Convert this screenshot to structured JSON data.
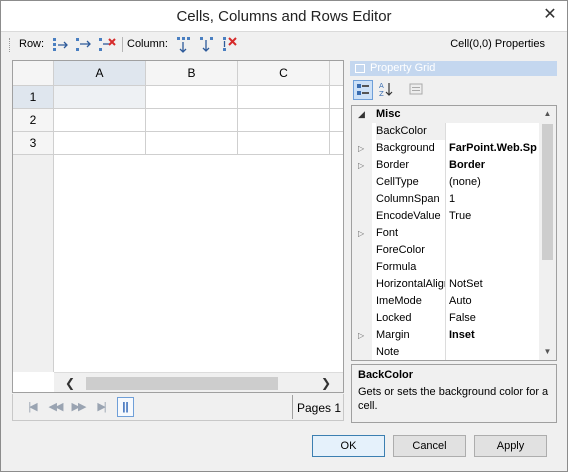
{
  "window": {
    "title": "Cells, Columns and Rows Editor"
  },
  "toolbar": {
    "row_label": "Row:",
    "column_label": "Column:",
    "row_icons": [
      "insert-row-icon",
      "append-row-icon",
      "delete-row-icon"
    ],
    "column_icons": [
      "insert-column-icon",
      "append-column-icon",
      "delete-column-icon"
    ],
    "selection_label": "Cell(0,0) Properties"
  },
  "sheet": {
    "columns": [
      "A",
      "B",
      "C"
    ],
    "rows": [
      "1",
      "2",
      "3"
    ],
    "selected_cell": "A1"
  },
  "pager": {
    "label": "Pages 1"
  },
  "property_grid": {
    "header": "Property Grid",
    "category": "Misc",
    "properties": [
      {
        "name": "BackColor",
        "value": "",
        "expandable": false,
        "bold": false,
        "selected": true
      },
      {
        "name": "Background",
        "value": "FarPoint.Web.Sp",
        "expandable": true,
        "bold": true,
        "selected": false
      },
      {
        "name": "Border",
        "value": "Border",
        "expandable": true,
        "bold": true,
        "selected": false
      },
      {
        "name": "CellType",
        "value": "(none)",
        "expandable": false,
        "bold": false,
        "selected": false
      },
      {
        "name": "ColumnSpan",
        "value": "1",
        "expandable": false,
        "bold": false,
        "selected": false
      },
      {
        "name": "EncodeValue",
        "value": "True",
        "expandable": false,
        "bold": false,
        "selected": false
      },
      {
        "name": "Font",
        "value": "",
        "expandable": true,
        "bold": false,
        "selected": false
      },
      {
        "name": "ForeColor",
        "value": "",
        "expandable": false,
        "bold": false,
        "selected": false
      },
      {
        "name": "Formula",
        "value": "",
        "expandable": false,
        "bold": false,
        "selected": false
      },
      {
        "name": "HorizontalAlign",
        "value": "NotSet",
        "expandable": false,
        "bold": false,
        "selected": false
      },
      {
        "name": "ImeMode",
        "value": "Auto",
        "expandable": false,
        "bold": false,
        "selected": false
      },
      {
        "name": "Locked",
        "value": "False",
        "expandable": false,
        "bold": false,
        "selected": false
      },
      {
        "name": "Margin",
        "value": "Inset",
        "expandable": true,
        "bold": true,
        "selected": false
      },
      {
        "name": "Note",
        "value": "",
        "expandable": false,
        "bold": false,
        "selected": false
      }
    ],
    "description": {
      "title": "BackColor",
      "text": "Gets or sets the background color for a cell."
    }
  },
  "buttons": {
    "ok": "OK",
    "cancel": "Cancel",
    "apply": "Apply"
  },
  "colors": {
    "selected_header": "#dfe6ee",
    "property_grid_header": "#c4d7ef",
    "focus_border": "#3c7fb1"
  }
}
